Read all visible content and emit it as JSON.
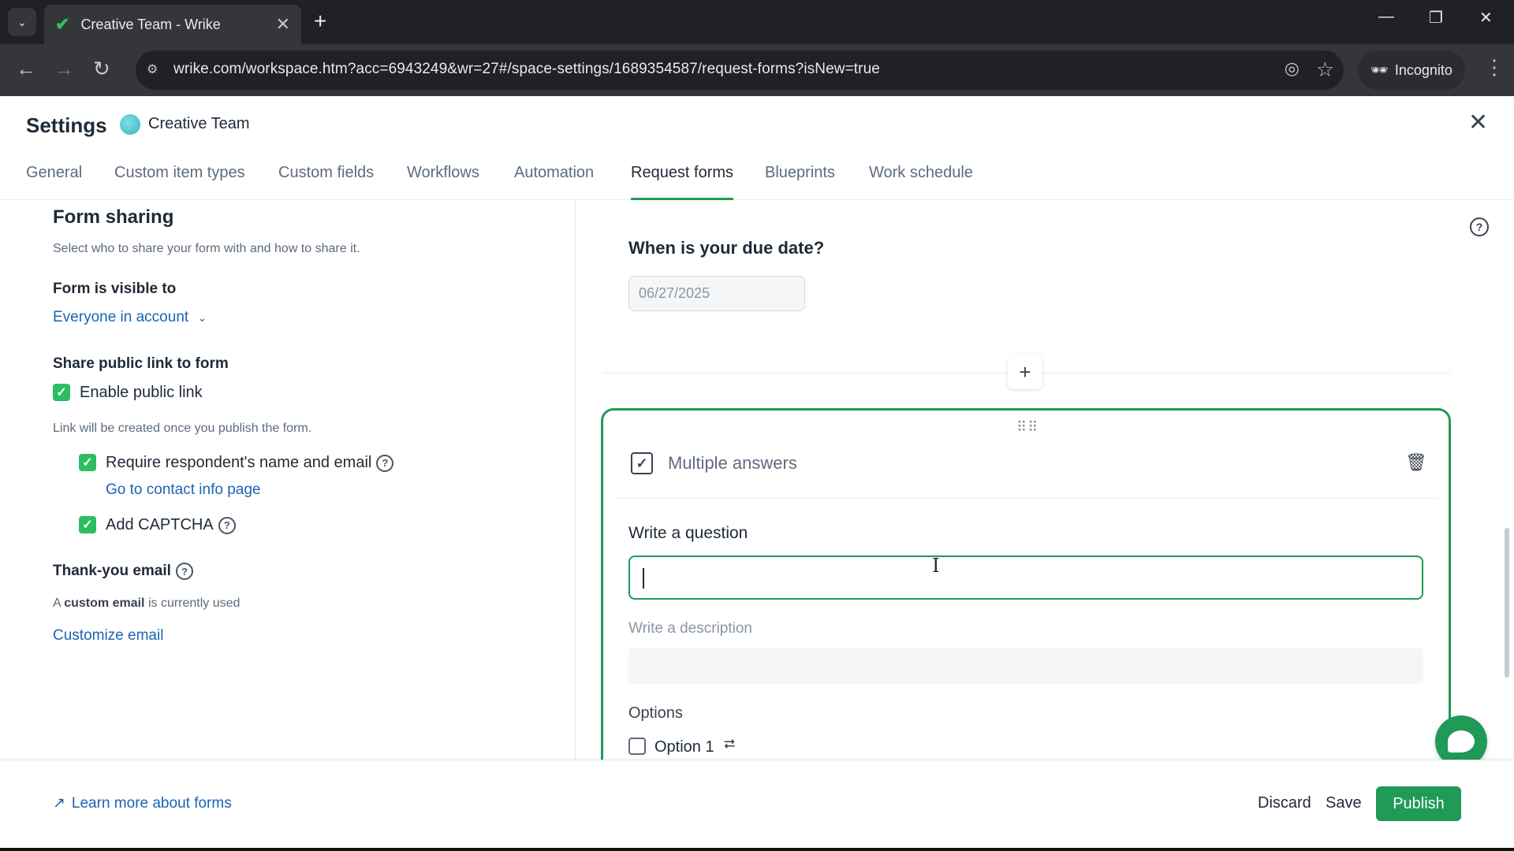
{
  "browser": {
    "tab_title": "Creative Team - Wrike",
    "url": "wrike.com/workspace.htm?acc=6943249&wr=27#/space-settings/1689354587/request-forms?isNew=true",
    "incognito_label": "Incognito"
  },
  "header": {
    "title": "Settings",
    "space_name": "Creative Team"
  },
  "tabs": [
    {
      "label": "General"
    },
    {
      "label": "Custom item types"
    },
    {
      "label": "Custom fields"
    },
    {
      "label": "Workflows"
    },
    {
      "label": "Automation"
    },
    {
      "label": "Request forms",
      "active": true
    },
    {
      "label": "Blueprints"
    },
    {
      "label": "Work schedule"
    }
  ],
  "sharing": {
    "heading": "Form sharing",
    "subtitle": "Select who to share your form with and how to share it.",
    "visible_heading": "Form is visible to",
    "visible_value": "Everyone in account",
    "public_heading": "Share public link to form",
    "enable_public_link": "Enable public link",
    "link_note": "Link will be created once you publish the form.",
    "require_name_email": "Require respondent's name and email",
    "contact_link": "Go to contact info page",
    "captcha": "Add CAPTCHA",
    "thankyou_heading": "Thank-you email",
    "thankyou_note_prefix": "A ",
    "thankyou_note_bold": "custom email",
    "thankyou_note_suffix": " is currently used",
    "customize_link": "Customize email"
  },
  "form": {
    "due_question": "When is your due date?",
    "due_placeholder": "06/27/2025",
    "card": {
      "type_label": "Multiple answers",
      "question_label": "Write a question",
      "question_value": "",
      "description_label": "Write a description",
      "options_label": "Options",
      "options": [
        "Option 1"
      ]
    }
  },
  "footer": {
    "learn_more": "Learn more about forms",
    "discard": "Discard",
    "save": "Save",
    "publish": "Publish"
  },
  "colors": {
    "accent": "#1f9a57",
    "checkbox": "#2dbe60",
    "link": "#1b63b5"
  }
}
